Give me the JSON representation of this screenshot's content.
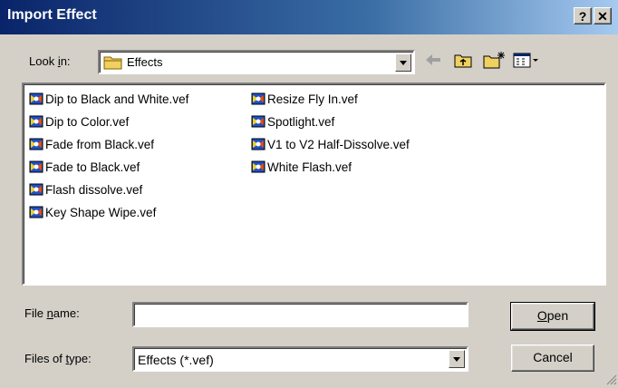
{
  "window": {
    "title": "Import Effect",
    "help_glyph": "?",
    "close_glyph": "✕"
  },
  "lookin": {
    "label_pre": "Look ",
    "label_ul": "i",
    "label_post": "n:",
    "value": "Effects"
  },
  "files": [
    "Dip to Black and White.vef",
    "Dip to Color.vef",
    "Fade from Black.vef",
    "Fade to Black.vef",
    "Flash dissolve.vef",
    "Key Shape Wipe.vef",
    "Resize Fly In.vef",
    "Spotlight.vef",
    "V1 to V2 Half-Dissolve.vef",
    "White Flash.vef"
  ],
  "filename": {
    "label_pre": "File ",
    "label_ul": "n",
    "label_post": "ame:",
    "value": ""
  },
  "filetype": {
    "label_pre": "Files of ",
    "label_ul": "t",
    "label_post": "ype:",
    "value": "Effects (*.vef)"
  },
  "buttons": {
    "open_ul": "O",
    "open_rest": "pen",
    "cancel": "Cancel"
  },
  "colors": {
    "titlebar_start": "#0a246a",
    "titlebar_end": "#a6caf0",
    "face": "#d4d0c8"
  }
}
